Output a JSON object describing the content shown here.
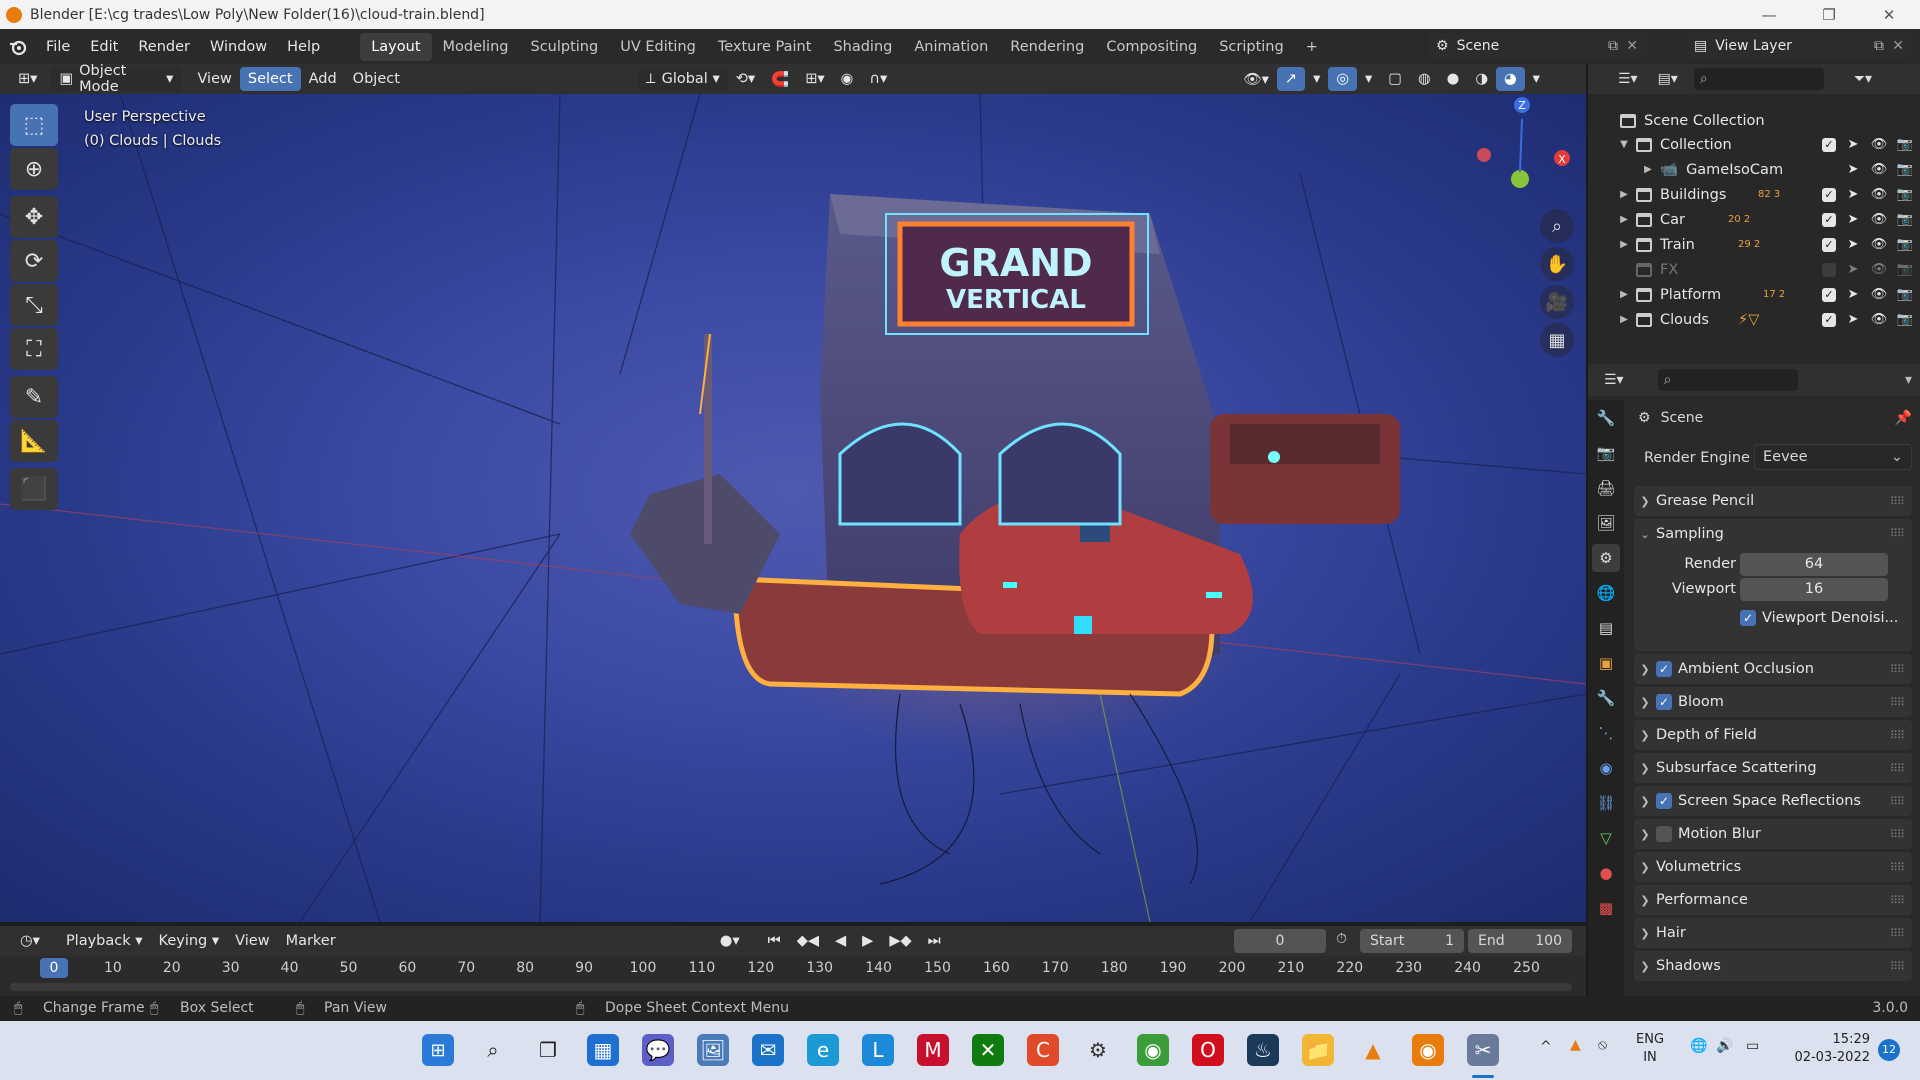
{
  "window": {
    "title": "Blender [E:\\cg trades\\Low Poly\\New Folder(16)\\cloud-train.blend]",
    "minimize": "—",
    "maximize": "❐",
    "close": "✕"
  },
  "menu": {
    "items": [
      "File",
      "Edit",
      "Render",
      "Window",
      "Help"
    ]
  },
  "workspaces": [
    "Layout",
    "Modeling",
    "Sculpting",
    "UV Editing",
    "Texture Paint",
    "Shading",
    "Animation",
    "Rendering",
    "Compositing",
    "Scripting",
    "+"
  ],
  "scene_field": "Scene",
  "view_layer_field": "View Layer",
  "header3d": {
    "mode": "Object Mode",
    "view": "View",
    "select": "Select",
    "add": "Add",
    "object": "Object",
    "transform": "Global"
  },
  "viewport": {
    "perspective": "User Perspective",
    "context": "(0) Clouds | Clouds",
    "sign_line1": "GRAND",
    "sign_line2": "VERTICAL",
    "axis_z": "Z",
    "axis_x": "X"
  },
  "outliner": {
    "root": "Scene Collection",
    "rows": [
      {
        "name": "Collection",
        "checked": true
      },
      {
        "name": "GameIsoCam",
        "checked": null
      },
      {
        "name": "Buildings",
        "checked": true,
        "badge": "82 3"
      },
      {
        "name": "Car",
        "checked": true,
        "badge": "20 2"
      },
      {
        "name": "Train",
        "checked": true,
        "badge": "29 2"
      },
      {
        "name": "FX",
        "checked": false
      },
      {
        "name": "Platform",
        "checked": true,
        "badge": "17 2"
      },
      {
        "name": "Clouds",
        "checked": true
      }
    ]
  },
  "properties": {
    "context": "Scene",
    "render_engine_label": "Render Engine",
    "render_engine": "Eevee",
    "grease_pencil": "Grease Pencil",
    "sampling": "Sampling",
    "render_label": "Render",
    "render_value": "64",
    "viewport_label": "Viewport",
    "viewport_value": "16",
    "viewport_denoise": "Viewport Denoisi...",
    "panels": [
      {
        "label": "Ambient Occlusion",
        "checkbox": true
      },
      {
        "label": "Bloom",
        "checkbox": true
      },
      {
        "label": "Depth of Field",
        "checkbox": null
      },
      {
        "label": "Subsurface Scattering",
        "checkbox": null
      },
      {
        "label": "Screen Space Reflections",
        "checkbox": true
      },
      {
        "label": "Motion Blur",
        "checkbox": false
      },
      {
        "label": "Volumetrics",
        "checkbox": null
      },
      {
        "label": "Performance",
        "checkbox": null
      },
      {
        "label": "Hair",
        "checkbox": null
      },
      {
        "label": "Shadows",
        "checkbox": null
      }
    ]
  },
  "timeline": {
    "playback": "Playback",
    "keying": "Keying",
    "view": "View",
    "marker": "Marker",
    "current_frame": "0",
    "start_label": "Start",
    "start": "1",
    "end_label": "End",
    "end": "100",
    "ticks": [
      "0",
      "10",
      "20",
      "30",
      "40",
      "50",
      "60",
      "70",
      "80",
      "90",
      "100",
      "110",
      "120",
      "130",
      "140",
      "150",
      "160",
      "170",
      "180",
      "190",
      "200",
      "210",
      "220",
      "230",
      "240",
      "250"
    ]
  },
  "statusbar": {
    "change_frame": "Change Frame",
    "box_select": "Box Select",
    "pan_view": "Pan View",
    "context_menu": "Dope Sheet Context Menu",
    "version": "3.0.0"
  },
  "taskbar": {
    "lang1": "ENG",
    "lang2": "IN",
    "time": "15:29",
    "date": "02-03-2022",
    "notifications": "12"
  }
}
